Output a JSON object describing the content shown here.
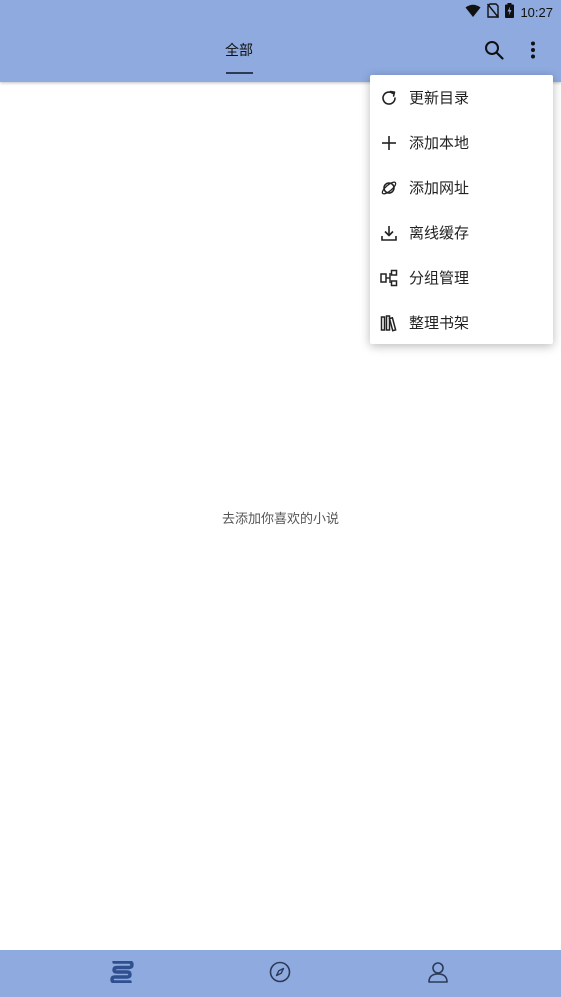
{
  "status_bar": {
    "time": "10:27",
    "icons": [
      "wifi-icon",
      "no-sim-icon",
      "battery-charging-icon"
    ]
  },
  "toolbar": {
    "tabs": [
      {
        "label": "全部",
        "selected": true
      }
    ],
    "actions": [
      "search-icon",
      "more-vert-icon"
    ]
  },
  "main": {
    "empty_message": "去添加你喜欢的小说"
  },
  "menu": {
    "items": [
      {
        "label": "更新目录",
        "icon": "refresh-icon"
      },
      {
        "label": "添加本地",
        "icon": "plus-icon"
      },
      {
        "label": "添加网址",
        "icon": "planet-icon"
      },
      {
        "label": "离线缓存",
        "icon": "download-icon"
      },
      {
        "label": "分组管理",
        "icon": "group-icon"
      },
      {
        "label": "整理书架",
        "icon": "bookshelf-icon"
      }
    ]
  },
  "bottom_nav": {
    "items": [
      {
        "icon": "bookshelf-nav-icon",
        "selected": true
      },
      {
        "icon": "compass-icon",
        "selected": false
      },
      {
        "icon": "person-icon",
        "selected": false
      }
    ]
  },
  "colors": {
    "primary": "#8eaadf",
    "accent_dark": "#2b3a58",
    "nav_selected": "#2f4f8f"
  }
}
